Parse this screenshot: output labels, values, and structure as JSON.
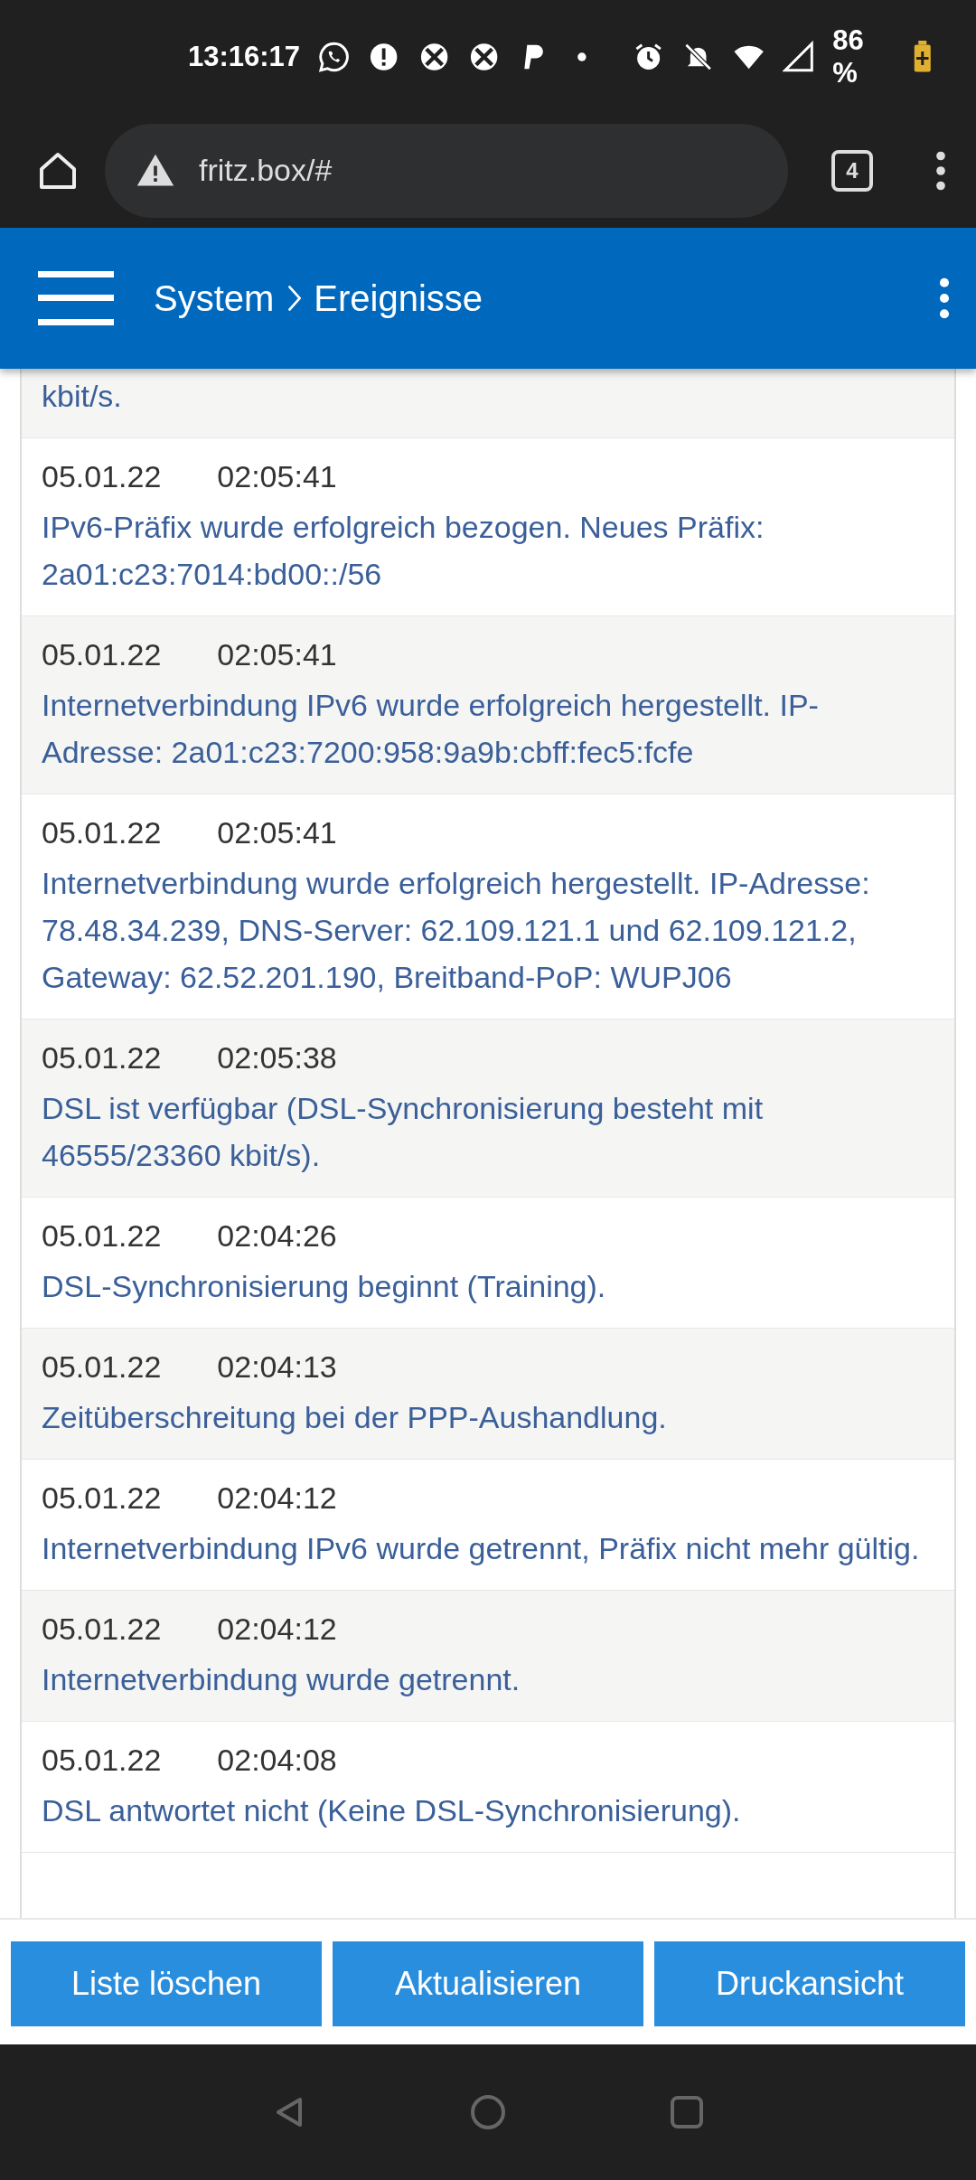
{
  "status_bar": {
    "time": "13:16:17",
    "battery": "86 %"
  },
  "browser": {
    "url": "fritz.box/#",
    "tab_count": "4"
  },
  "header": {
    "breadcrumb": [
      "System",
      "Ereignisse"
    ]
  },
  "events_partial": {
    "message": "kbit/s."
  },
  "events": [
    {
      "date": "05.01.22",
      "time": "02:05:41",
      "message": "IPv6-Präfix wurde erfolgreich bezogen. Neues Präfix: 2a01:c23:7014:bd00::/56"
    },
    {
      "date": "05.01.22",
      "time": "02:05:41",
      "message": "Internetverbindung IPv6 wurde erfolgreich hergestellt. IP-Adresse: 2a01:c23:7200:958:9a9b:cbff:fec5:fcfe"
    },
    {
      "date": "05.01.22",
      "time": "02:05:41",
      "message": "Internetverbindung wurde erfolgreich hergestellt. IP-Adresse: 78.48.34.239, DNS-Server: 62.109.121.1 und 62.109.121.2, Gateway: 62.52.201.190, Breitband-PoP: WUPJ06"
    },
    {
      "date": "05.01.22",
      "time": "02:05:38",
      "message": "DSL ist verfügbar (DSL-Synchronisierung besteht mit 46555/23360 kbit/s)."
    },
    {
      "date": "05.01.22",
      "time": "02:04:26",
      "message": "DSL-Synchronisierung beginnt (Training)."
    },
    {
      "date": "05.01.22",
      "time": "02:04:13",
      "message": "Zeitüberschreitung bei der PPP-Aushandlung."
    },
    {
      "date": "05.01.22",
      "time": "02:04:12",
      "message": "Internetverbindung IPv6 wurde getrennt, Präfix nicht mehr gültig."
    },
    {
      "date": "05.01.22",
      "time": "02:04:12",
      "message": "Internetverbindung wurde getrennt."
    },
    {
      "date": "05.01.22",
      "time": "02:04:08",
      "message": "DSL antwortet nicht (Keine DSL-Synchronisierung)."
    }
  ],
  "buttons": [
    "Liste löschen",
    "Aktualisieren",
    "Druckansicht"
  ]
}
